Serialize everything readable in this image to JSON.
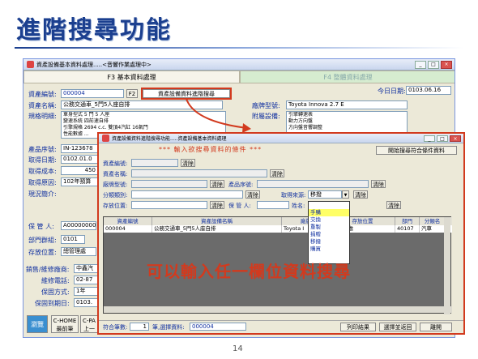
{
  "slide": {
    "title": "進階搜尋功能",
    "page_number": "14"
  },
  "main_window": {
    "title": "資產設備基本資料處理.....<音響作業處理中>",
    "tabs": [
      "F3 基本資料處理",
      "F4 整體資料處理"
    ],
    "today_label": "今日日期:",
    "today_value": "0103.06.16",
    "fields": {
      "asset_no_label": "資產編號:",
      "asset_no_value": "000004",
      "f2_button": "F2",
      "advanced_search_button": "資產設備資料進階搜尋",
      "asset_name_label": "資產名稱:",
      "asset_name_value": "公務交通車_5門5人座自排",
      "spec_label": "規格明細:",
      "spec_value_1": "車身型式 5 門 5 人座",
      "spec_value_2": "變速系統 四前速自排",
      "spec_value_3": "引擎規格 2694 c.c. 雙頂4汽缸 16氣門",
      "spec_value_4": "性能數據 ...",
      "model_label": "廠牌型號:",
      "model_value": "Toyota Innova 2.7 E",
      "accessory_label": "附屬設備:",
      "accessory_value_1": "引擎轉速表",
      "accessory_value_2": "動力方向盤",
      "accessory_value_3": "方向盤音響調整",
      "serial_label": "產品序號:",
      "serial_value": "IN-123678",
      "acquire_date_label": "取得日期:",
      "acquire_date_value": "0102.01.0",
      "acquire_cost_label": "取得成本:",
      "acquire_cost_value": "450",
      "acquire_reason_label": "取得原因:",
      "acquire_reason_value": "102年預算",
      "status_label": "現況簡介:",
      "keeper_label": "保 管 人:",
      "keeper_value": "A00000000",
      "dept_label": "部門群組:",
      "dept_value": "0101",
      "location_label": "存放位置:",
      "location_value": "總管理處",
      "vendor_label": "銷售/維修廠商:",
      "vendor_value": "中鑫汽",
      "repair_phone_label": "維修電話:",
      "repair_phone_value": "02-87",
      "warranty_label": "保固方式:",
      "warranty_value": "1年",
      "warranty_end_label": "保固到期日:",
      "warranty_end_value": "0103."
    },
    "status_bar": {
      "browse_label": "瀏覽",
      "chome_label": "C-HOME",
      "chome_sub": "最前筆",
      "cpage_label": "C-PA",
      "cpage_sub": "上一"
    }
  },
  "search_window": {
    "title": "資產設備資料進階搜尋功能.....資產設備基本資料處理",
    "heading": "*** 輸入欲搜尋資料的條件 ***",
    "start_button": "開始搜尋符合條件資料",
    "clear": "清除",
    "labels": {
      "asset_no": "資產編號:",
      "asset_name": "資產名稱:",
      "model": "廠牌型號:",
      "serial": "產品序號:",
      "category": "分類類別:",
      "source": "取得來源:",
      "location": "存放位置:",
      "keeper": "保 管 人:",
      "name": "姓名:"
    },
    "source_value": "移撥",
    "source_options": [
      "",
      "手購",
      "交換",
      "重製",
      "捐贈",
      "移撥",
      "購買"
    ],
    "grid_headers": [
      "資產編號",
      "資產設備名稱",
      "廠牌",
      "存放位置",
      "部門",
      "分類名"
    ],
    "grid_rows": [
      [
        "000004",
        "公務交通車_5門5人座自排",
        "Toyota I",
        "總管理處",
        "40107",
        "汽車"
      ]
    ],
    "bottom": {
      "count_label": "符合筆數:",
      "count_value": "1",
      "selected_label": "筆,選擇資料:",
      "selected_value": "000004",
      "print_button": "列印結果",
      "select_back_button": "選擇並返回",
      "leave_button": "離開"
    },
    "overlay_text": "可以輸入任一欄位資料搜尋"
  },
  "colors": {
    "title_blue": "#1b3f8f",
    "highlight_red": "#d23a1e",
    "label_blue": "#1030a0",
    "window_bg": "#ece9d8"
  }
}
